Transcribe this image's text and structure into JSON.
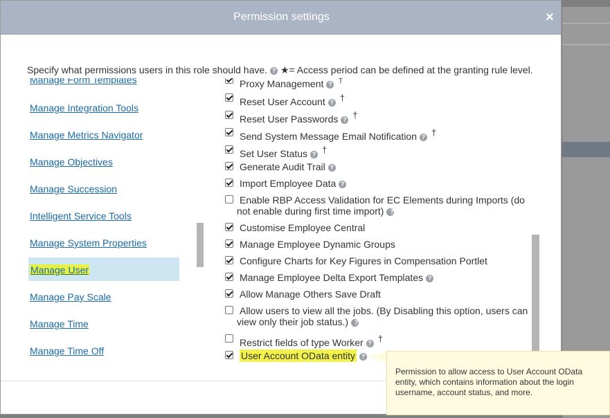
{
  "dialog": {
    "title": "Permission settings",
    "close_label": "×",
    "intro_text": "Specify what permissions users in this role should have.",
    "intro_star_text": "★= Access period can be defined at the granting rule level."
  },
  "left_nav": {
    "items": [
      {
        "label": "Manage Form Templates"
      },
      {
        "label": "Manage Integration Tools"
      },
      {
        "label": "Manage Metrics Navigator"
      },
      {
        "label": "Manage Objectives"
      },
      {
        "label": "Manage Succession"
      },
      {
        "label": "Intelligent Service Tools"
      },
      {
        "label": "Manage System Properties"
      },
      {
        "label": "Manage User",
        "selected": true
      },
      {
        "label": "Manage Pay Scale"
      },
      {
        "label": "Manage Time"
      },
      {
        "label": "Manage Time Off"
      }
    ]
  },
  "permissions": [
    {
      "label": "Proxy Management",
      "checked": true,
      "help": true,
      "dagger": true
    },
    {
      "label": "Reset User Account",
      "checked": true,
      "help": true,
      "dagger": true
    },
    {
      "label": "Reset User Passwords",
      "checked": true,
      "help": true,
      "dagger": true
    },
    {
      "label": "Send System Message Email Notification",
      "checked": true,
      "help": true,
      "dagger": true
    },
    {
      "label": "Set User Status",
      "checked": true,
      "help": true,
      "dagger": true
    },
    {
      "label": "Generate Audit Trail",
      "checked": true,
      "help": true,
      "dagger": false
    },
    {
      "label": "Import Employee Data",
      "checked": true,
      "help": true,
      "dagger": false
    },
    {
      "label": "Enable RBP Access Validation for EC Elements during Imports (do not enable during first time import)",
      "checked": false,
      "help": true,
      "dagger": false
    },
    {
      "label": "Customise Employee Central",
      "checked": true,
      "help": false,
      "dagger": false
    },
    {
      "label": "Manage Employee Dynamic Groups",
      "checked": true,
      "help": false,
      "dagger": false
    },
    {
      "label": "Configure Charts for Key Figures in Compensation Portlet",
      "checked": true,
      "help": false,
      "dagger": false
    },
    {
      "label": "Manage Employee Delta Export Templates",
      "checked": true,
      "help": true,
      "dagger": false
    },
    {
      "label": "Allow Manage Others Save Draft",
      "checked": true,
      "help": false,
      "dagger": false
    },
    {
      "label": "Allow users to view all the jobs. (By Disabling this option, users can view only their job status.)",
      "checked": false,
      "help": true,
      "dagger": false
    },
    {
      "label": "Restrict fields of type Worker",
      "checked": false,
      "help": true,
      "dagger": true
    },
    {
      "label": "User Account OData entity",
      "checked": true,
      "help": true,
      "dagger": false,
      "highlighted": true
    }
  ],
  "tooltip": {
    "text": "Permission to allow access to User Account OData entity, which contains information about the login username, account status, and more."
  },
  "symbols": {
    "help": "?",
    "dagger": "†"
  },
  "colors": {
    "titlebar": "#aab4c4",
    "link": "#1a6aa6",
    "selected_bg": "#cde6f2",
    "highlight": "#f2f24a",
    "tooltip_bg": "#fefbe0"
  }
}
